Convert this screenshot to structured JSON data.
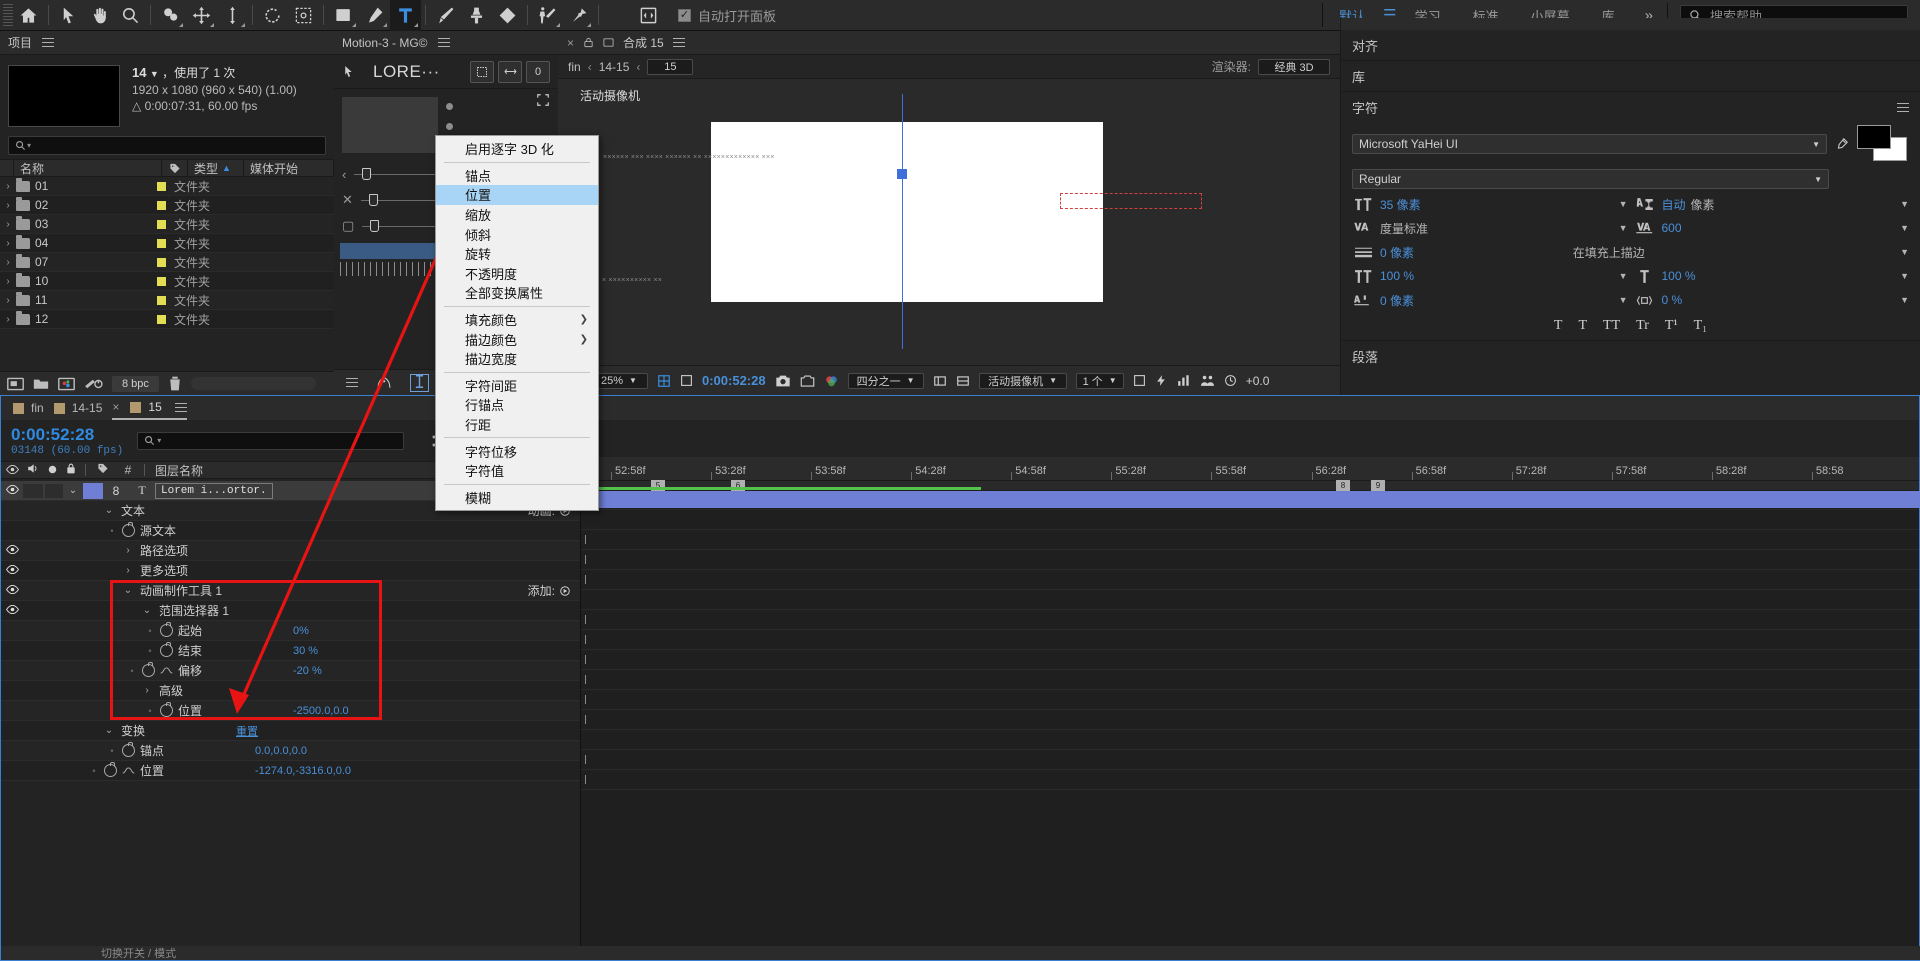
{
  "app": {
    "name": "Adobe After Effects"
  },
  "toolbar": {
    "tools": [
      {
        "name": "home-icon",
        "label": "主页"
      },
      {
        "name": "selection-tool-icon",
        "label": "选取工具"
      },
      {
        "name": "hand-tool-icon",
        "label": "手形工具"
      },
      {
        "name": "zoom-tool-icon",
        "label": "缩放工具"
      },
      {
        "name": "orbit-tool-icon",
        "label": "环绕工具"
      },
      {
        "name": "pan-tool-icon",
        "label": "平移工具"
      },
      {
        "name": "dolly-tool-icon",
        "label": "推拉工具"
      },
      {
        "name": "rotation-tool-icon",
        "label": "旋转工具"
      },
      {
        "name": "anchor-point-tool-icon",
        "label": "向后平移(锚点)工具"
      },
      {
        "name": "rectangle-tool-icon",
        "label": "矩形工具"
      },
      {
        "name": "pen-tool-icon",
        "label": "钢笔工具"
      },
      {
        "name": "text-tool-icon",
        "label": "横排文字工具"
      },
      {
        "name": "brush-tool-icon",
        "label": "画笔工具"
      },
      {
        "name": "clone-stamp-tool-icon",
        "label": "仿制图章工具"
      },
      {
        "name": "eraser-tool-icon",
        "label": "橡皮擦工具"
      },
      {
        "name": "roto-brush-tool-icon",
        "label": "Roto 笔刷工具"
      },
      {
        "name": "puppet-pin-tool-icon",
        "label": "人偶位置控点工具"
      }
    ],
    "auto_open_panel": "自动打开面板",
    "auto_open_checked": true,
    "workspaces": [
      "默认",
      "学习",
      "标准",
      "小屏幕",
      "库"
    ],
    "workspace_selected": "默认",
    "more_chevron": "»",
    "help_placeholder": "搜索帮助"
  },
  "project": {
    "title": "项目",
    "item": {
      "name": "14",
      "usage": "，使用了 1 次",
      "dimensions": "1920 x 1080  (960 x 540) (1.00)",
      "duration": "0:00:07:31, 60.00 fps"
    },
    "search_placeholder": "",
    "columns": [
      "名称",
      "类型",
      "媒体开始"
    ],
    "rows": [
      {
        "name": "01",
        "type": "文件夹"
      },
      {
        "name": "02",
        "type": "文件夹"
      },
      {
        "name": "03",
        "type": "文件夹"
      },
      {
        "name": "04",
        "type": "文件夹"
      },
      {
        "name": "07",
        "type": "文件夹"
      },
      {
        "name": "10",
        "type": "文件夹"
      },
      {
        "name": "11",
        "type": "文件夹"
      },
      {
        "name": "12",
        "type": "文件夹"
      }
    ],
    "footer": {
      "bit_depth": "8 bpc"
    }
  },
  "midpanel": {
    "title": "Motion-3 - MG©",
    "preset_label": "LORE···",
    "buttons": [
      "0"
    ]
  },
  "comp": {
    "tabs": [
      "合成 15"
    ],
    "nav": {
      "prev_items": [
        "fin",
        "14-15"
      ],
      "current": "15"
    },
    "renderer_label": "渲染器:",
    "renderer_value": "经典 3D",
    "camera_label": "活动摄像机",
    "canvas_texts": [
      "×××××× ××× ×××× ×××××× ×× ××××××××××××× ×××",
      "× ×××××××××× ××"
    ],
    "footer": {
      "zoom": "25%",
      "time": "0:00:52:28",
      "resolution": "四分之一",
      "view": "活动摄像机",
      "views_count": "1 个",
      "exposure": "+0.0"
    }
  },
  "right": {
    "align_title": "对齐",
    "library_title": "库",
    "character_title": "字符",
    "paragraph_title": "段落",
    "font_family": "Microsoft YaHei UI",
    "font_style": "Regular",
    "font_size": "35 像素",
    "leading": "自动",
    "leading_unit": "像素",
    "kerning": "度量标准",
    "tracking": "600",
    "stroke_width": "0 像素",
    "stroke_mode": "在填充上描边",
    "vertical_scale": "100 %",
    "horizontal_scale": "100 %",
    "baseline_shift": "0 像素",
    "tsume": "0 %",
    "style_buttons": [
      "T",
      "T",
      "TT",
      "Tr",
      "T¹",
      "T₁"
    ]
  },
  "context_menu": {
    "items": [
      {
        "label": "启用逐字 3D 化",
        "type": "item"
      },
      {
        "type": "sep"
      },
      {
        "label": "锚点",
        "type": "item"
      },
      {
        "label": "位置",
        "type": "item",
        "highlighted": true
      },
      {
        "label": "缩放",
        "type": "item"
      },
      {
        "label": "倾斜",
        "type": "item"
      },
      {
        "label": "旋转",
        "type": "item"
      },
      {
        "label": "不透明度",
        "type": "item"
      },
      {
        "label": "全部变换属性",
        "type": "item"
      },
      {
        "type": "sep"
      },
      {
        "label": "填充颜色",
        "type": "item",
        "submenu": true
      },
      {
        "label": "描边颜色",
        "type": "item",
        "submenu": true
      },
      {
        "label": "描边宽度",
        "type": "item"
      },
      {
        "type": "sep"
      },
      {
        "label": "字符间距",
        "type": "item"
      },
      {
        "label": "行锚点",
        "type": "item"
      },
      {
        "label": "行距",
        "type": "item"
      },
      {
        "type": "sep"
      },
      {
        "label": "字符位移",
        "type": "item"
      },
      {
        "label": "字符值",
        "type": "item"
      },
      {
        "type": "sep"
      },
      {
        "label": "模糊",
        "type": "item"
      }
    ]
  },
  "timeline": {
    "tabs": [
      {
        "label": "fin",
        "selected": false
      },
      {
        "label": "14-15",
        "selected": false
      },
      {
        "label": "15",
        "selected": true
      }
    ],
    "current_time": "0:00:52:28",
    "frame_info": "03148  (60.00 fps)",
    "search_placeholder": "",
    "column_header": "图层名称",
    "layer": {
      "index": "8",
      "type_icon": "T",
      "name": "Lorem i...ortor."
    },
    "rows": [
      {
        "indent": 1,
        "twirl": "open",
        "label": "文本",
        "value": "",
        "extra": "动画:",
        "eye": false
      },
      {
        "indent": 2,
        "twirl": "none",
        "label": "源文本",
        "value": "",
        "stopwatch": true,
        "eye": false
      },
      {
        "indent": 2,
        "twirl": "closed",
        "label": "路径选项",
        "value": "",
        "eye": true
      },
      {
        "indent": 2,
        "twirl": "closed",
        "label": "更多选项",
        "value": "",
        "eye": true
      },
      {
        "indent": 2,
        "twirl": "open",
        "label": "动画制作工具 1",
        "value": "",
        "extra": "添加:",
        "eye": true
      },
      {
        "indent": 3,
        "twirl": "open",
        "label": "范围选择器 1",
        "value": "",
        "eye": true
      },
      {
        "indent": 4,
        "twirl": "none",
        "label": "起始",
        "value": "0%",
        "stopwatch": true,
        "eye": false
      },
      {
        "indent": 4,
        "twirl": "none",
        "label": "结束",
        "value": "30 %",
        "stopwatch": true,
        "eye": false
      },
      {
        "indent": 4,
        "twirl": "none",
        "label": "偏移",
        "value": "-20 %",
        "stopwatch": true,
        "graph": true,
        "eye": false
      },
      {
        "indent": 3,
        "twirl": "closed",
        "label": "高级",
        "value": "",
        "eye": false
      },
      {
        "indent": 4,
        "twirl": "none",
        "label": "位置",
        "value": "-2500.0,0.0",
        "stopwatch": true,
        "eye": false
      },
      {
        "indent": 1,
        "twirl": "open",
        "label": "变换",
        "value": "重置",
        "reset": true,
        "eye": false
      },
      {
        "indent": 2,
        "twirl": "none",
        "label": "锚点",
        "value": "0.0,0.0,0.0",
        "stopwatch": true,
        "eye": false
      },
      {
        "indent": 2,
        "twirl": "none",
        "label": "位置",
        "value": "-1274.0,-3316.0,0.0",
        "stopwatch": true,
        "graph": true,
        "eye": false
      }
    ],
    "bottom_hint": "切换开关 / 模式",
    "ruler_ticks": [
      "52:58f",
      "53:28f",
      "53:58f",
      "54:28f",
      "54:58f",
      "55:28f",
      "55:58f",
      "56:28f",
      "56:58f",
      "57:28f",
      "57:58f",
      "58:28f",
      "58:58"
    ],
    "markers": [
      "5",
      "6",
      "8",
      "9"
    ]
  },
  "colors": {
    "accent_blue": "#3a8fe0",
    "menu_highlight": "#a8d4f5",
    "annotation_red": "#e81414",
    "folder_yellow": "#e2dd52",
    "layer_bar": "#6f7fd6",
    "render_green": "#53c24a"
  }
}
